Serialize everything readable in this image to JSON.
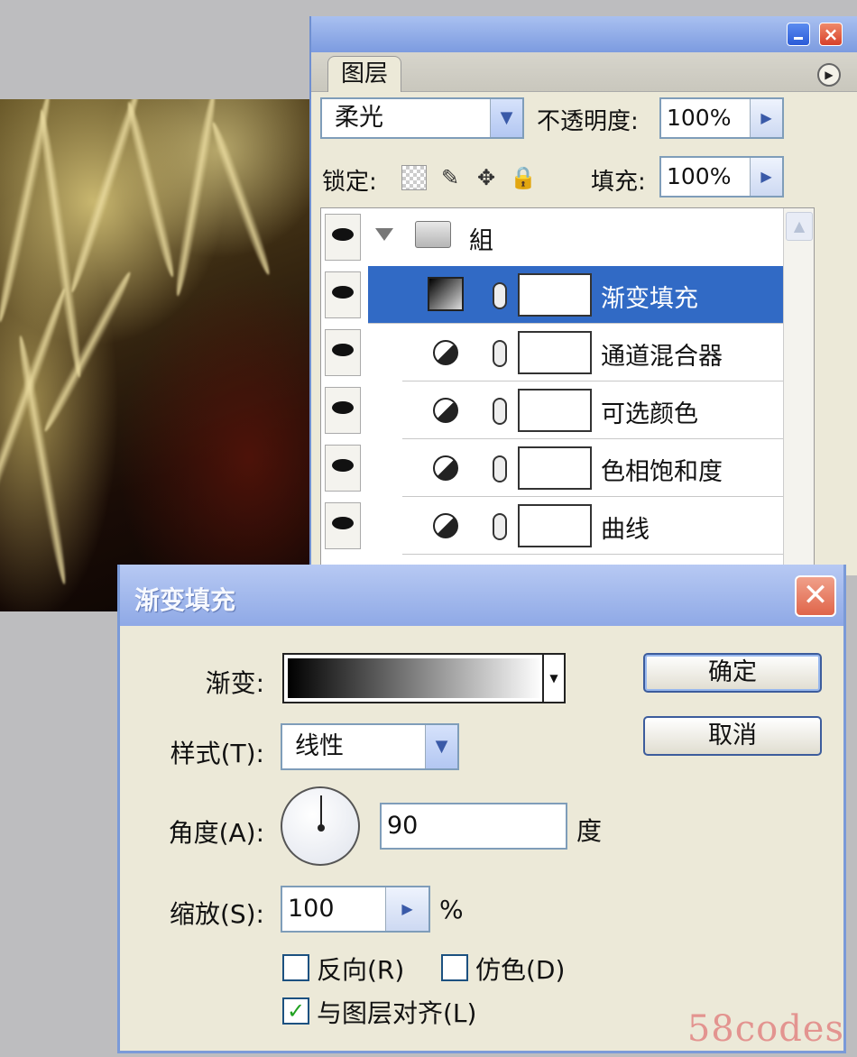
{
  "layers_panel": {
    "tab": "图层",
    "blend_mode": "柔光",
    "opacity_label": "不透明度:",
    "opacity_value": "100%",
    "lock_label": "锁定:",
    "fill_label": "填充:",
    "fill_value": "100%",
    "group": {
      "name": "組"
    },
    "layers": [
      {
        "name": "渐变填充",
        "selected": true,
        "thumb": "gradient-thumb"
      },
      {
        "name": "通道混合器",
        "selected": false,
        "thumb": "adjustment-icon"
      },
      {
        "name": "可选颜色",
        "selected": false,
        "thumb": "adjustment-icon"
      },
      {
        "name": "色相饱和度",
        "selected": false,
        "thumb": "adjustment-icon"
      },
      {
        "name": "曲线",
        "selected": false,
        "thumb": "adjustment-icon"
      }
    ]
  },
  "dialog": {
    "title": "渐变填充",
    "gradient_label": "渐变:",
    "style_label": "样式(T):",
    "style_value": "线性",
    "angle_label": "角度(A):",
    "angle_value": "90",
    "angle_unit": "度",
    "scale_label": "缩放(S):",
    "scale_value": "100",
    "scale_unit": "%",
    "reverse_label": "反向(R)",
    "reverse_checked": false,
    "dither_label": "仿色(D)",
    "dither_checked": false,
    "align_label": "与图层对齐(L)",
    "align_checked": true,
    "ok_label": "确定",
    "cancel_label": "取消",
    "gradient_colors": [
      "#000000",
      "#ffffff"
    ]
  },
  "watermark": "58codes",
  "colors": {
    "selection": "#316ac5",
    "title_bar": "#8fa9e6"
  }
}
